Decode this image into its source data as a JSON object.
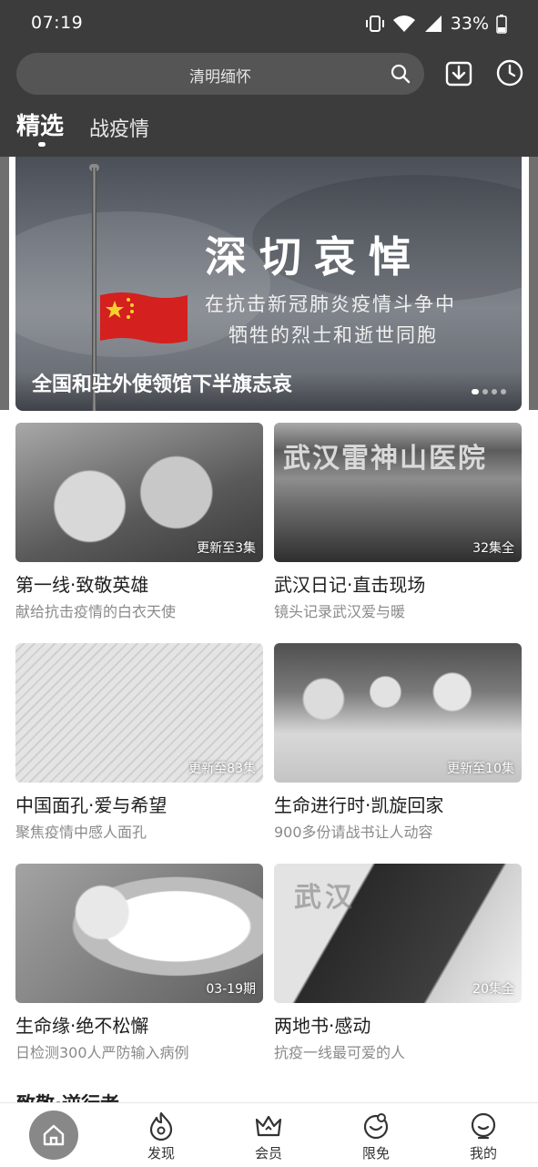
{
  "status_bar": {
    "time": "07:19",
    "battery": "33%"
  },
  "search": {
    "placeholder": "清明缅怀"
  },
  "tabs": [
    {
      "label": "精选",
      "active": true
    },
    {
      "label": "战疫情",
      "active": false
    }
  ],
  "banner": {
    "headline": "深切哀悼",
    "subline_1": "在抗击新冠肺炎疫情斗争中",
    "subline_2": "牺牲的烈士和逝世同胞",
    "caption": "全国和驻外使领馆下半旗志哀",
    "page_dots": 4,
    "active_dot": 1
  },
  "cards": [
    {
      "title": "第一线·致敬英雄",
      "desc": "献给抗击疫情的白衣天使",
      "badge": "更新至3集"
    },
    {
      "title": "武汉日记·直击现场",
      "desc": "镜头记录武汉爱与暖",
      "badge": "32集全",
      "image_text": "武汉雷神山医院"
    },
    {
      "title": "中国面孔·爱与希望",
      "desc": "聚焦疫情中感人面孔",
      "badge": "更新至83集"
    },
    {
      "title": "生命进行时·凯旋回家",
      "desc": "900多份请战书让人动容",
      "badge": "更新至10集"
    },
    {
      "title": "生命缘·绝不松懈",
      "desc": "日检测300人严防输入病例",
      "badge": "03-19期"
    },
    {
      "title": "两地书·感动",
      "desc": "抗疫一线最可爱的人",
      "badge": "20集全",
      "image_text": "武汉"
    }
  ],
  "next_section_partial": "致敬·逆行者",
  "bottom_nav": [
    {
      "label": "",
      "icon": "home-icon",
      "active": true
    },
    {
      "label": "发现",
      "icon": "discover-icon"
    },
    {
      "label": "会员",
      "icon": "crown-icon"
    },
    {
      "label": "限免",
      "icon": "free-icon"
    },
    {
      "label": "我的",
      "icon": "profile-icon"
    }
  ],
  "colors": {
    "header_bg": "#3c3c3c",
    "search_bg": "#555555",
    "text_dark": "#1e1e1e",
    "text_muted": "#8a8a8a"
  }
}
